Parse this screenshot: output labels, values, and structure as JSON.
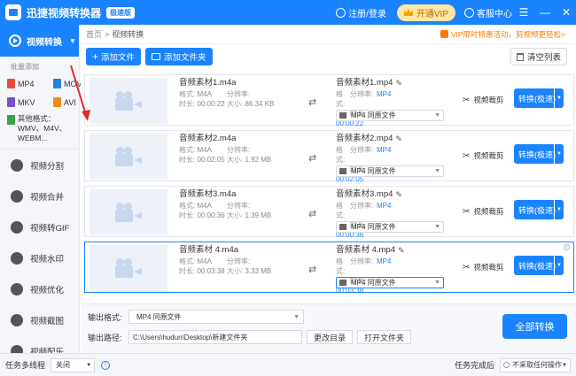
{
  "app": {
    "title": "迅捷视频转换器",
    "edition": "极速版",
    "login": "注册/登录",
    "vip": "开通VIP",
    "service": "客服中心"
  },
  "sidebar": {
    "active": "视频转换",
    "hint": "批量添加",
    "formats": [
      "MP4",
      "MOV",
      "MKV",
      "AVI"
    ],
    "other_label": "其他格式：WMV、M4V、WEBM...",
    "items": [
      "视频分割",
      "视频合并",
      "视频转GIF",
      "视频水印",
      "视频优化",
      "视频截图",
      "视频配乐"
    ]
  },
  "breadcrumb": {
    "home": "首页",
    "sep": ">",
    "current": "视频转换"
  },
  "promo": "VIP限时特惠活动，剪视频更轻松>",
  "toolbar": {
    "add_file": "添加文件",
    "add_folder": "添加文件夹",
    "clear": "清空列表"
  },
  "labels": {
    "format": "格式:",
    "duration": "时长:",
    "resolution": "分辨率:",
    "size": "大小:",
    "clip": "视频裁剪",
    "convert": "转换(极速)"
  },
  "files": [
    {
      "name": "音频素材1.m4a",
      "format": "M4A",
      "duration": "00:00:22",
      "resolution": "",
      "size": "86.34 KB",
      "out_name": "音频素材1.mp4",
      "out_format": "MP4",
      "out_duration": "00:00:22",
      "out_select": "MP4    同原文件"
    },
    {
      "name": "音频素材2.m4a",
      "format": "M4A",
      "duration": "00:02:05",
      "resolution": "",
      "size": "1.92 MB",
      "out_name": "音频素材2.mp4",
      "out_format": "MP4",
      "out_duration": "00:02:05",
      "out_select": "MP4    同原文件"
    },
    {
      "name": "音频素材3.m4a",
      "format": "M4A",
      "duration": "00:00:36",
      "resolution": "",
      "size": "1.39 MB",
      "out_name": "音频素材3.mp4",
      "out_format": "MP4",
      "out_duration": "00:00:36",
      "out_select": "MP4    同原文件"
    },
    {
      "name": "音频素材 4.m4a",
      "format": "M4A",
      "duration": "00:03:38",
      "resolution": "",
      "size": "3.33 MB",
      "out_name": "音频素材 4.mp4",
      "out_format": "MP4",
      "out_duration": "00:03:38",
      "out_select": "MP4    同原文件"
    }
  ],
  "output": {
    "format_label": "输出格式:",
    "format_value": "MP4    同原文件",
    "path_label": "输出路径:",
    "path_value": "C:\\Users\\hudun\\Desktop\\新建文件夹",
    "change_dir": "更改目录",
    "open_folder": "打开文件夹",
    "convert_all": "全部转换"
  },
  "status": {
    "multi_label": "任务多线程",
    "multi_value": "关闭",
    "done_label": "任务完成后",
    "done_value": "不采取任何操作"
  },
  "colors": {
    "primary": "#1a83ff",
    "vip": "#ffe6a6",
    "promo": "#ff7a00",
    "annotation": "#e02a2a"
  }
}
